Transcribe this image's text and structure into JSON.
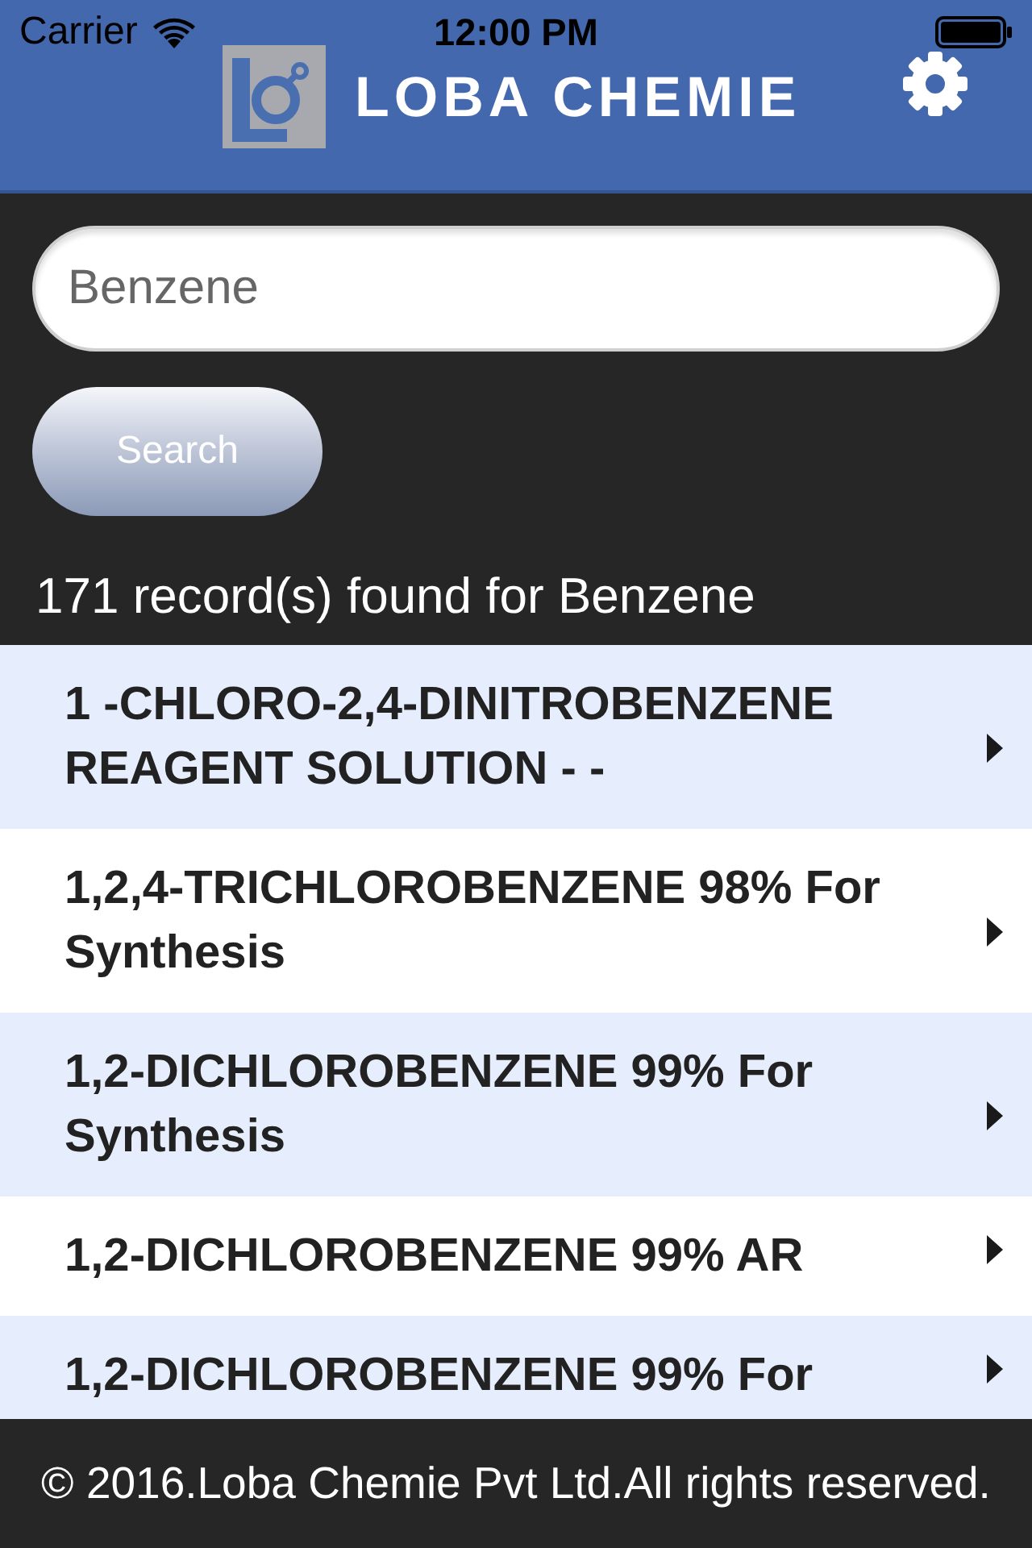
{
  "status_bar": {
    "carrier": "Carrier",
    "time": "12:00 PM"
  },
  "header": {
    "title": "LOBA CHEMIE"
  },
  "search": {
    "value": "Benzene",
    "button": "Search"
  },
  "results_summary": "171 record(s) found for Benzene",
  "results": [
    {
      "name": "1 -CHLORO-2,4-DINITROBENZENE REAGENT SOLUTION - -"
    },
    {
      "name": "1,2,4-TRICHLOROBENZENE 98% For Synthesis"
    },
    {
      "name": "1,2-DICHLOROBENZENE 99% For Synthesis"
    },
    {
      "name": "1,2-DICHLOROBENZENE 99% AR"
    },
    {
      "name": "1,2-DICHLOROBENZENE 99% For"
    }
  ],
  "footer": "© 2016.Loba Chemie Pvt Ltd.All rights reserved."
}
